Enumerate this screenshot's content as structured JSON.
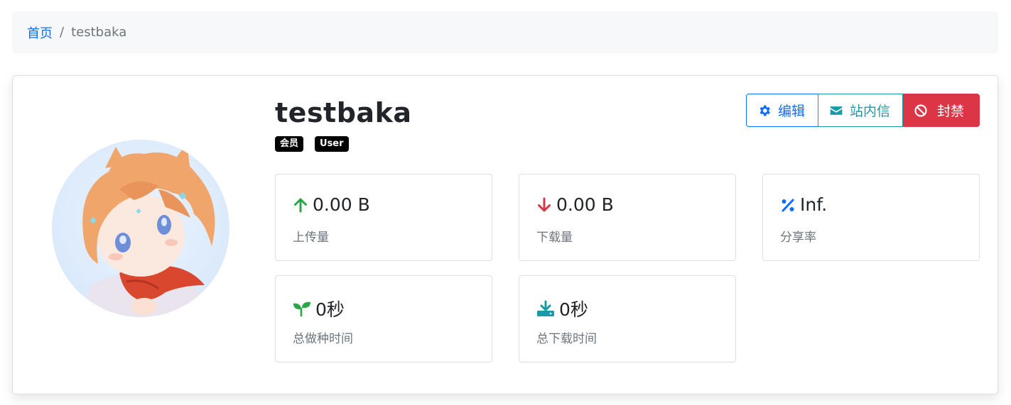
{
  "breadcrumb": {
    "home": "首页",
    "separator": "/",
    "current": "testbaka"
  },
  "profile": {
    "username": "testbaka",
    "badges": [
      "会员",
      "User"
    ]
  },
  "actions": {
    "edit": "编辑",
    "message": "站内信",
    "ban": "封禁"
  },
  "stats": [
    {
      "value": "0.00 B",
      "label": "上传量",
      "icon": "arrow-up-icon",
      "color": "#28a745"
    },
    {
      "value": "0.00 B",
      "label": "下载量",
      "icon": "arrow-down-icon",
      "color": "#dc3545"
    },
    {
      "value": "Inf.",
      "label": "分享率",
      "icon": "percent-icon",
      "color": "#0d6efd"
    },
    {
      "value": "0秒",
      "label": "总做种时间",
      "icon": "seedling-icon",
      "color": "#28a745"
    },
    {
      "value": "0秒",
      "label": "总下载时间",
      "icon": "download-icon",
      "color": "#1a9aa8"
    }
  ],
  "colors": {
    "primary": "#0d6efd",
    "info": "#1a9aa8",
    "danger": "#dc3545",
    "success": "#28a745"
  }
}
